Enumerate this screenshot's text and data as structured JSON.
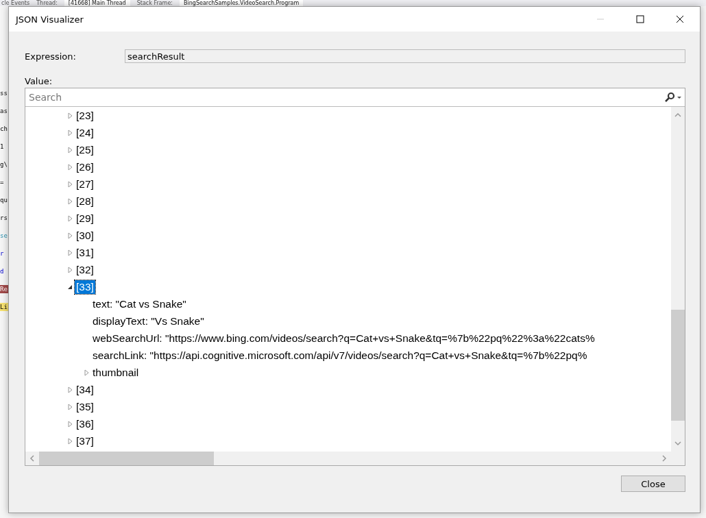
{
  "background": {
    "toolbar": [
      "cle Events",
      "Thread:",
      "[41668] Main Thread",
      "Stack Frame:",
      "BingSearchSamples.VideoSearch.Program"
    ],
    "code_fragments": [
      "ss",
      "as",
      "ch",
      "1",
      "g\\",
      "=",
      "qu",
      "rs",
      "se",
      "r",
      "d",
      "Re",
      "Li"
    ]
  },
  "window": {
    "title": "JSON Visualizer"
  },
  "expression": {
    "label": "Expression:",
    "value": "searchResult"
  },
  "value_label": "Value:",
  "search": {
    "placeholder": "Search"
  },
  "tree": [
    {
      "label": "[23]",
      "expanded": false,
      "selected": false
    },
    {
      "label": "[24]",
      "expanded": false,
      "selected": false
    },
    {
      "label": "[25]",
      "expanded": false,
      "selected": false
    },
    {
      "label": "[26]",
      "expanded": false,
      "selected": false
    },
    {
      "label": "[27]",
      "expanded": false,
      "selected": false
    },
    {
      "label": "[28]",
      "expanded": false,
      "selected": false
    },
    {
      "label": "[29]",
      "expanded": false,
      "selected": false
    },
    {
      "label": "[30]",
      "expanded": false,
      "selected": false
    },
    {
      "label": "[31]",
      "expanded": false,
      "selected": false
    },
    {
      "label": "[32]",
      "expanded": false,
      "selected": false
    },
    {
      "label": "[33]",
      "expanded": true,
      "selected": true,
      "children": [
        {
          "label": "text: \"Cat vs Snake\"",
          "selected": false
        },
        {
          "label": "displayText: \"Vs Snake\"",
          "selected": false
        },
        {
          "label": "webSearchUrl: \"https://www.bing.com/videos/search?q=Cat+vs+Snake&tq=%7b%22pq%22%3a%22cats%",
          "selected": false
        },
        {
          "label": "searchLink: \"https://api.cognitive.microsoft.com/api/v7/videos/search?q=Cat+vs+Snake&tq=%7b%22pq%",
          "selected": false
        },
        {
          "label": "thumbnail",
          "expanded": false,
          "selected": false
        }
      ]
    },
    {
      "label": "[34]",
      "expanded": false,
      "selected": false
    },
    {
      "label": "[35]",
      "expanded": false,
      "selected": false
    },
    {
      "label": "[36]",
      "expanded": false,
      "selected": false
    },
    {
      "label": "[37]",
      "expanded": false,
      "selected": false
    }
  ],
  "buttons": [
    "Close"
  ]
}
